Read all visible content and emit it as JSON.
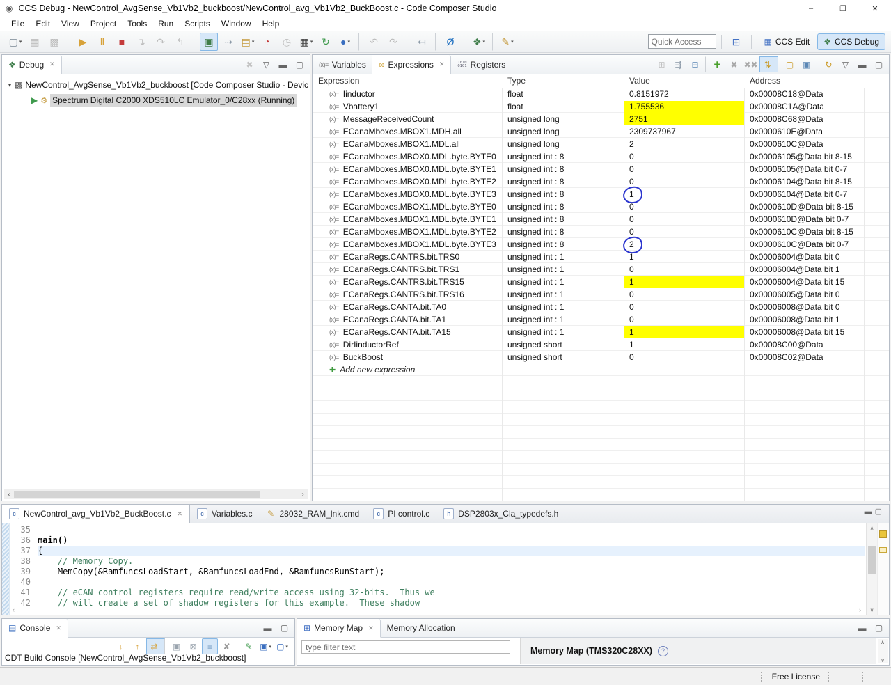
{
  "ui": {
    "close_glyph": "✕",
    "dropdown_glyph": "▾",
    "left_arrow": "‹",
    "right_arrow": "›",
    "up_arrow": "∧",
    "down_arrow": "∨",
    "view_menu_glyph": "▽",
    "min_glyph": "▬",
    "max_glyph": "▢",
    "help_glyph": "?"
  },
  "window": {
    "icon_glyph": "◉",
    "title": "CCS Debug - NewControl_AvgSense_Vb1Vb2_buckboost/NewControl_avg_Vb1Vb2_BuckBoost.c - Code Composer Studio",
    "controls": [
      {
        "name": "minimize-button",
        "glyph": "–"
      },
      {
        "name": "restore-button",
        "glyph": "❐"
      },
      {
        "name": "close-button",
        "glyph": "✕"
      }
    ]
  },
  "menu": {
    "items": [
      "File",
      "Edit",
      "View",
      "Project",
      "Tools",
      "Run",
      "Scripts",
      "Window",
      "Help"
    ]
  },
  "toolbar": {
    "icons": [
      {
        "name": "new-file-icon",
        "glyph": "▢",
        "color": "#7a8894",
        "dropdown": true
      },
      {
        "name": "save-icon",
        "glyph": "▦",
        "color": "#bcbcbc"
      },
      {
        "name": "save-all-icon",
        "glyph": "▩",
        "color": "#bcbcbc",
        "sep_after": true
      },
      {
        "name": "resume-icon",
        "glyph": "▶",
        "color": "#d7a23a"
      },
      {
        "name": "pause-icon",
        "glyph": "Ⅱ",
        "color": "#d7a23a"
      },
      {
        "name": "stop-icon",
        "glyph": "■",
        "color": "#c43b3b"
      },
      {
        "name": "step-into-icon",
        "glyph": "↴",
        "color": "#bcbcbc"
      },
      {
        "name": "step-over-icon",
        "glyph": "↷",
        "color": "#bcbcbc"
      },
      {
        "name": "step-return-icon",
        "glyph": "↰",
        "color": "#bcbcbc",
        "sep_after": true
      },
      {
        "name": "connect-target-icon",
        "glyph": "▣",
        "color": "#3f7d4a",
        "selected": true
      },
      {
        "name": "source-lookup-icon",
        "glyph": "⇢",
        "color": "#8a98a6"
      },
      {
        "name": "load-program-icon",
        "glyph": "▤",
        "color": "#c59b3f",
        "dropdown": true
      },
      {
        "name": "profile-clock-icon",
        "glyph": "◔",
        "color": "#c43b3b"
      },
      {
        "name": "clock-icon",
        "glyph": "◷",
        "color": "#bcbcbc"
      },
      {
        "name": "chip-icon",
        "glyph": "▦",
        "color": "#444444",
        "dropdown": true
      },
      {
        "name": "restart-icon",
        "glyph": "↻",
        "color": "#3f9a4d"
      },
      {
        "name": "world-icon",
        "glyph": "●",
        "color": "#3a6ebf",
        "dropdown": true,
        "sep_after": true
      },
      {
        "name": "back-icon",
        "glyph": "↶",
        "color": "#bcbcbc"
      },
      {
        "name": "forward-icon",
        "glyph": "↷",
        "color": "#bcbcbc",
        "sep_after": true
      },
      {
        "name": "last-edit-location-icon",
        "glyph": "↤",
        "color": "#8a98a6",
        "sep_after": true
      },
      {
        "name": "search-icon",
        "glyph": "Ø",
        "color": "#1b6dbf",
        "sep_after": true
      },
      {
        "name": "debug-icon",
        "glyph": "❖",
        "color": "#3f7d4a",
        "dropdown": true,
        "sep_after": true
      },
      {
        "name": "highlight-icon",
        "glyph": "✎",
        "color": "#c59b3f",
        "dropdown": true
      }
    ],
    "quick_access_placeholder": "Quick Access",
    "open_perspective_glyph": "⊞",
    "perspectives": [
      {
        "name": "ccs-edit-perspective-button",
        "label": "CCS Edit",
        "glyph": "▦",
        "color": "#4472c4",
        "active": false
      },
      {
        "name": "ccs-debug-perspective-button",
        "label": "CCS Debug",
        "glyph": "❖",
        "color": "#3f7d4a",
        "active": true
      }
    ]
  },
  "debug": {
    "tab": "Debug",
    "tab_icon": "❖",
    "toolbar": [
      {
        "name": "remove-all-terminated-icon",
        "glyph": "✖",
        "color": "#c3c3c3"
      },
      {
        "name": "view-menu-icon",
        "glyph": "▽",
        "color": "#666666"
      },
      {
        "name": "minimize-icon",
        "glyph": "▬",
        "color": "#666666"
      },
      {
        "name": "maximize-icon",
        "glyph": "▢",
        "color": "#666666"
      }
    ],
    "tree": [
      {
        "expander": "▾",
        "icon1": "▩",
        "icon1_color": "#555555",
        "icon2": "",
        "label": "NewControl_AvgSense_Vb1Vb2_buckboost [Code Composer Studio - Devic",
        "selected": false
      },
      {
        "expander": "",
        "icon1": "▶",
        "icon1_color": "#3f9a4d",
        "icon2": "⚙",
        "icon2_color": "#c59b3f",
        "label": "Spectrum Digital C2000 XDS510LC Emulator_0/C28xx (Running)",
        "selected": true,
        "indent": true
      }
    ]
  },
  "expressions": {
    "var_icon": "(x)=",
    "glasses_icon": "∞",
    "reg_icon_top": "1010",
    "reg_icon_bottom": "0101",
    "add_icon": "✚",
    "tabs": [
      {
        "tabname": "tab-variables",
        "label": "Variables",
        "icon_var": true
      },
      {
        "tabname": "tab-expressions",
        "label": "Expressions",
        "icon_glasses": true,
        "active": true,
        "closable": true
      },
      {
        "tabname": "tab-registers",
        "label": "Registers",
        "icon_reg": true
      }
    ],
    "toolbar": [
      {
        "name": "show-type-names-icon",
        "glyph": "⊞",
        "color": "#c0c0c0"
      },
      {
        "name": "show-logical-structure-icon",
        "glyph": "⇶",
        "color": "#8a98a6"
      },
      {
        "name": "collapse-all-icon",
        "glyph": "⊟",
        "color": "#5b87b5",
        "sep_after": true
      },
      {
        "name": "add-expression-icon",
        "glyph": "✚",
        "color": "#4aa02c"
      },
      {
        "name": "remove-expression-icon",
        "glyph": "✖",
        "color": "#a9a9a9"
      },
      {
        "name": "remove-all-expressions-icon",
        "glyph": "✖✖",
        "color": "#a9a9a9"
      },
      {
        "name": "auto-update-icon",
        "glyph": "⇅",
        "color": "#c9971f",
        "selected": true,
        "sep_after": true
      },
      {
        "name": "new-expressions-view-icon",
        "glyph": "▢",
        "color": "#c9971f"
      },
      {
        "name": "pin-view-icon",
        "glyph": "▣",
        "color": "#5b87b5",
        "sep_after": true
      },
      {
        "name": "refresh-icon",
        "glyph": "↻",
        "color": "#c9971f"
      },
      {
        "name": "view-menu-icon",
        "glyph": "▽",
        "color": "#666666"
      },
      {
        "name": "minimize-icon",
        "glyph": "▬",
        "color": "#666666"
      },
      {
        "name": "maximize-icon",
        "glyph": "▢",
        "color": "#666666"
      }
    ],
    "columns": [
      "Expression",
      "Type",
      "Value",
      "Address"
    ],
    "highlight_color": "#ffff00",
    "annotation_color": "#2b35cf",
    "rows": [
      {
        "expr": "Iinductor",
        "type": "float",
        "value": "0.8151972",
        "address": "0x00008C18@Data"
      },
      {
        "expr": "Vbattery1",
        "type": "float",
        "value": "1.755536",
        "address": "0x00008C1A@Data",
        "hl": true
      },
      {
        "expr": "MessageReceivedCount",
        "type": "unsigned long",
        "value": "2751",
        "address": "0x00008C68@Data",
        "hl": true
      },
      {
        "expr": "ECanaMboxes.MBOX1.MDH.all",
        "type": "unsigned long",
        "value": "2309737967",
        "address": "0x0000610E@Data"
      },
      {
        "expr": "ECanaMboxes.MBOX1.MDL.all",
        "type": "unsigned long",
        "value": "2",
        "address": "0x0000610C@Data"
      },
      {
        "expr": "ECanaMboxes.MBOX0.MDL.byte.BYTE0",
        "type": "unsigned int : 8",
        "value": "0",
        "address": "0x00006105@Data bit 8-15"
      },
      {
        "expr": "ECanaMboxes.MBOX0.MDL.byte.BYTE1",
        "type": "unsigned int : 8",
        "value": "0",
        "address": "0x00006105@Data bit 0-7"
      },
      {
        "expr": "ECanaMboxes.MBOX0.MDL.byte.BYTE2",
        "type": "unsigned int : 8",
        "value": "0",
        "address": "0x00006104@Data bit 8-15"
      },
      {
        "expr": "ECanaMboxes.MBOX0.MDL.byte.BYTE3",
        "type": "unsigned int : 8",
        "value": "1",
        "address": "0x00006104@Data bit 0-7",
        "circled": true
      },
      {
        "expr": "ECanaMboxes.MBOX1.MDL.byte.BYTE0",
        "type": "unsigned int : 8",
        "value": "0",
        "address": "0x0000610D@Data bit 8-15"
      },
      {
        "expr": "ECanaMboxes.MBOX1.MDL.byte.BYTE1",
        "type": "unsigned int : 8",
        "value": "0",
        "address": "0x0000610D@Data bit 0-7"
      },
      {
        "expr": "ECanaMboxes.MBOX1.MDL.byte.BYTE2",
        "type": "unsigned int : 8",
        "value": "0",
        "address": "0x0000610C@Data bit 8-15"
      },
      {
        "expr": "ECanaMboxes.MBOX1.MDL.byte.BYTE3",
        "type": "unsigned int : 8",
        "value": "2",
        "address": "0x0000610C@Data bit 0-7",
        "circled": true
      },
      {
        "expr": "ECanaRegs.CANTRS.bit.TRS0",
        "type": "unsigned int : 1",
        "value": "1",
        "address": "0x00006004@Data bit 0"
      },
      {
        "expr": "ECanaRegs.CANTRS.bit.TRS1",
        "type": "unsigned int : 1",
        "value": "0",
        "address": "0x00006004@Data bit 1"
      },
      {
        "expr": "ECanaRegs.CANTRS.bit.TRS15",
        "type": "unsigned int : 1",
        "value": "1",
        "address": "0x00006004@Data bit 15",
        "hl": true
      },
      {
        "expr": "ECanaRegs.CANTRS.bit.TRS16",
        "type": "unsigned int : 1",
        "value": "0",
        "address": "0x00006005@Data bit 0"
      },
      {
        "expr": "ECanaRegs.CANTA.bit.TA0",
        "type": "unsigned int : 1",
        "value": "0",
        "address": "0x00006008@Data bit 0"
      },
      {
        "expr": "ECanaRegs.CANTA.bit.TA1",
        "type": "unsigned int : 1",
        "value": "0",
        "address": "0x00006008@Data bit 1"
      },
      {
        "expr": "ECanaRegs.CANTA.bit.TA15",
        "type": "unsigned int : 1",
        "value": "1",
        "address": "0x00006008@Data bit 15",
        "hl": true
      },
      {
        "expr": "DirIinductorRef",
        "type": "unsigned short",
        "value": "1",
        "address": "0x00008C00@Data"
      },
      {
        "expr": "BuckBoost",
        "type": "unsigned short",
        "value": "0",
        "address": "0x00008C02@Data"
      }
    ],
    "add_row_label": "Add new expression"
  },
  "editor": {
    "tabs": [
      {
        "name": "editor-tab-buckboost",
        "label": "NewControl_avg_Vb1Vb2_BuckBoost.c",
        "icon": "c",
        "icon_glyph": "c",
        "active": true,
        "closable": true
      },
      {
        "name": "editor-tab-variables",
        "label": "Variables.c",
        "icon": "c",
        "icon_glyph": "c"
      },
      {
        "name": "editor-tab-ram-lnk",
        "label": "28032_RAM_lnk.cmd",
        "icon": "cmd",
        "icon_glyph": "✎"
      },
      {
        "name": "editor-tab-pi-control",
        "label": "PI control.c",
        "icon": "c",
        "icon_glyph": "c"
      },
      {
        "name": "editor-tab-typedefs",
        "label": "DSP2803x_Cla_typedefs.h",
        "icon": "h",
        "icon_glyph": "h"
      }
    ],
    "lines": [
      {
        "num": "35",
        "text": ""
      },
      {
        "num": "36",
        "text": "main()",
        "bold": true
      },
      {
        "num": "37",
        "text": "{",
        "current": true
      },
      {
        "num": "38",
        "text": "    // Memory Copy.",
        "comment": true
      },
      {
        "num": "39",
        "text": "    MemCopy(&RamfuncsLoadStart, &RamfuncsLoadEnd, &RamfuncsRunStart);"
      },
      {
        "num": "40",
        "text": ""
      },
      {
        "num": "41",
        "text": "    // eCAN control registers require read/write access using 32-bits.  Thus we",
        "comment": true
      },
      {
        "num": "42",
        "text": "    // will create a set of shadow registers for this example.  These shadow",
        "comment": true
      }
    ]
  },
  "console": {
    "tab": "Console",
    "tab_icon": "▤",
    "toolbar": [
      {
        "name": "scroll-down-icon",
        "glyph": "↓",
        "color": "#d7a23a"
      },
      {
        "name": "scroll-up-icon",
        "glyph": "↑",
        "color": "#d7a23a"
      },
      {
        "name": "follow-output-icon",
        "glyph": "⇄",
        "color": "#d7a23a",
        "selected": true,
        "sep_after": true
      },
      {
        "name": "show-output-icon",
        "glyph": "▣",
        "color": "#9aa4ae"
      },
      {
        "name": "scroll-lock-icon",
        "glyph": "⊠",
        "color": "#9aa4ae"
      },
      {
        "name": "word-wrap-icon",
        "glyph": "≡",
        "color": "#5b87b5",
        "selected": true
      },
      {
        "name": "clear-console-icon",
        "glyph": "✘",
        "color": "#9a9a9a",
        "sep_after": true
      },
      {
        "name": "pin-console-icon",
        "glyph": "✎",
        "color": "#3f9a4d"
      },
      {
        "name": "display-console-icon",
        "glyph": "▣",
        "color": "#3a6ebf",
        "dropdown": true
      },
      {
        "name": "open-console-icon",
        "glyph": "▢",
        "color": "#3a6ebf",
        "dropdown": true
      }
    ],
    "text": "CDT Build Console [NewControl_AvgSense_Vb1Vb2_buckboost]"
  },
  "memory": {
    "tabs": [
      {
        "tabname": "tab-memory-map",
        "label": "Memory Map",
        "icon_glyph": "⊞",
        "icon_color": "#4472c4",
        "active": true,
        "closable": true
      },
      {
        "tabname": "tab-memory-allocation",
        "label": "Memory Allocation"
      }
    ],
    "filter_placeholder": "type filter text",
    "map_title": "Memory Map (TMS320C28XX)"
  },
  "status": {
    "license": "Free License"
  }
}
